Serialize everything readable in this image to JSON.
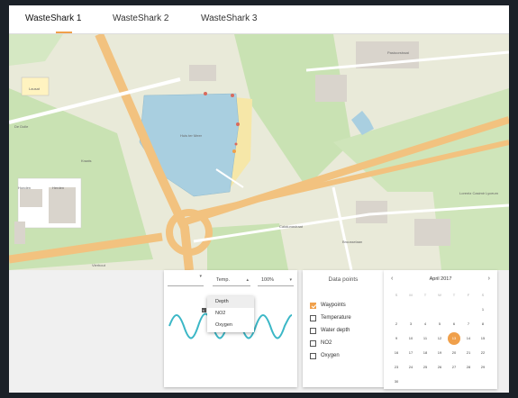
{
  "tabs": [
    {
      "label": "WasteShark 1",
      "active": true
    },
    {
      "label": "WasteShark 2",
      "active": false
    },
    {
      "label": "WasteShark 3",
      "active": false
    }
  ],
  "colors": {
    "accent": "#f0a04b",
    "water": "#a9cfe0",
    "road": "#f2c27f",
    "park": "#c9e2b3",
    "wave": "#3bb7c6"
  },
  "map": {
    "labels": [
      "Lausat",
      "De Dolle",
      "Kraats",
      "Honden",
      "Herden",
      "Huis ter Meer",
      "Pastoorstraat",
      "Lorentz Casimir Lyceum",
      "Catalunastraat",
      "Bruusselaan",
      "Vierhout"
    ]
  },
  "chart": {
    "selects": [
      {
        "value": "",
        "icon": "chevron-down-icon"
      },
      {
        "value": "Temp.",
        "icon": "caret-up-icon"
      },
      {
        "value": "100%",
        "icon": "chevron-down-icon"
      }
    ],
    "dropdown": {
      "items": [
        "Depth",
        "NO2",
        "Oxygen"
      ],
      "highlighted": 0
    },
    "marker": "6"
  },
  "datapoints": {
    "title": "Data points",
    "items": [
      {
        "label": "Waypoints",
        "checked": true
      },
      {
        "label": "Temperature",
        "checked": false
      },
      {
        "label": "Water depth",
        "checked": false
      },
      {
        "label": "NO2",
        "checked": false
      },
      {
        "label": "Oxygen",
        "checked": false
      }
    ]
  },
  "calendar": {
    "title": "April 2017",
    "prev": "‹",
    "next": "›",
    "weekdays": [
      "S",
      "M",
      "T",
      "W",
      "T",
      "F",
      "S"
    ],
    "weeks": [
      [
        "",
        "",
        "",
        "",
        "",
        "",
        "1"
      ],
      [
        "2",
        "3",
        "4",
        "5",
        "6",
        "7",
        "8"
      ],
      [
        "9",
        "10",
        "11",
        "12",
        "13",
        "14",
        "15"
      ],
      [
        "16",
        "17",
        "18",
        "19",
        "20",
        "21",
        "22"
      ],
      [
        "23",
        "24",
        "25",
        "26",
        "27",
        "28",
        "29"
      ],
      [
        "30",
        "",
        "",
        "",
        "",
        "",
        ""
      ]
    ],
    "selected": "13"
  }
}
